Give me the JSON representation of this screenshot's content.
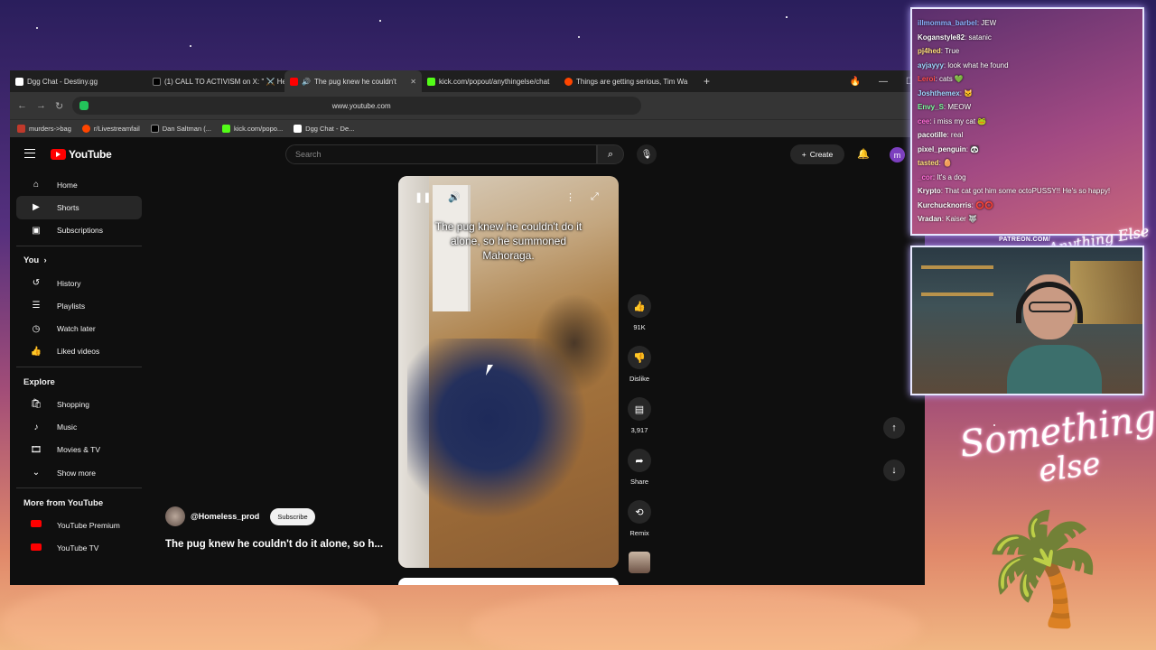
{
  "browser": {
    "tabs": [
      {
        "title": "Dgg Chat - Destiny.gg",
        "favicon_color": "#ffffff"
      },
      {
        "title": "(1) CALL TO ACTIVISM on X: \" ⚔️ He",
        "favicon_color": "#000000"
      },
      {
        "title": "The pug knew he couldn't",
        "favicon_color": "#ff0000",
        "active": true
      },
      {
        "title": "kick.com/popout/anythingelse/chat",
        "favicon_color": "#53fc18"
      },
      {
        "title": "Things are getting serious, Tim Wa",
        "favicon_color": "#ff4500"
      }
    ],
    "url": "www.youtube.com",
    "bookmarks": [
      "murders->bag",
      "r/Livestreamfail",
      "Dan Saltman (...",
      "kick.com/popo...",
      "Dgg Chat - De..."
    ]
  },
  "youtube": {
    "logo_text": "YouTube",
    "search_placeholder": "Search",
    "create_label": "Create",
    "avatar_letter": "m",
    "sidebar": {
      "main": [
        "Home",
        "Shorts",
        "Subscriptions"
      ],
      "you_heading": "You",
      "you": [
        "History",
        "Playlists",
        "Watch later",
        "Liked videos"
      ],
      "explore_heading": "Explore",
      "explore": [
        "Shopping",
        "Music",
        "Movies & TV",
        "Show more"
      ],
      "more_heading": "More from YouTube",
      "more": [
        "YouTube Premium",
        "YouTube TV"
      ]
    },
    "short": {
      "caption": "The pug knew he couldn't do it alone, so he summoned Mahoraga.",
      "likes": "91K",
      "dislike_label": "Dislike",
      "comments": "3,917",
      "share_label": "Share",
      "remix_label": "Remix",
      "channel": "@Homeless_prod",
      "subscribe_label": "Subscribe",
      "title": "The pug knew he couldn't do it alone, so h..."
    }
  },
  "stream_overlay": {
    "chat": [
      {
        "name": "illmomma_barbel",
        "msg": "JEW",
        "color": "#8ab4ff"
      },
      {
        "name": "Koganstyle82",
        "msg": "satanic",
        "color": "#ffffff"
      },
      {
        "name": "pj4hed",
        "msg": "True",
        "color": "#ffe07a"
      },
      {
        "name": "ayjayyy",
        "msg": "look what he found",
        "color": "#9ed8ff"
      },
      {
        "name": "Leroi",
        "msg": "cats 💚",
        "color": "#ff4d4d"
      },
      {
        "name": "Joshthemex",
        "msg": "🐱",
        "color": "#9ed8ff"
      },
      {
        "name": "Envy_S",
        "msg": "MEOW",
        "color": "#7dff9e"
      },
      {
        "name": "cee",
        "msg": "i miss my cat 🐸",
        "color": "#ff6bd6"
      },
      {
        "name": "pacotille",
        "msg": "real",
        "color": "#ffffff"
      },
      {
        "name": "pixel_penguin",
        "msg": "🐼",
        "color": "#ffffff"
      },
      {
        "name": "tasted",
        "msg": "🥚",
        "color": "#ffe07a"
      },
      {
        "name": "_cor",
        "msg": "It's a dog",
        "color": "#ff6bd6"
      },
      {
        "name": "Krypto",
        "msg": "That cat got him some octoPUSSY!! He's so happy!",
        "color": "#ffffff"
      },
      {
        "name": "Kurchucknorris",
        "msg": "⭕⭕",
        "color": "#ffffff"
      },
      {
        "name": "Vradan",
        "msg": "Kaiser 🐺",
        "color": "#ffffff"
      }
    ],
    "patreon_text": "PATREON.COM/",
    "brand_text": "Anything Else",
    "signature_line1": "Something",
    "signature_line2": "else"
  }
}
